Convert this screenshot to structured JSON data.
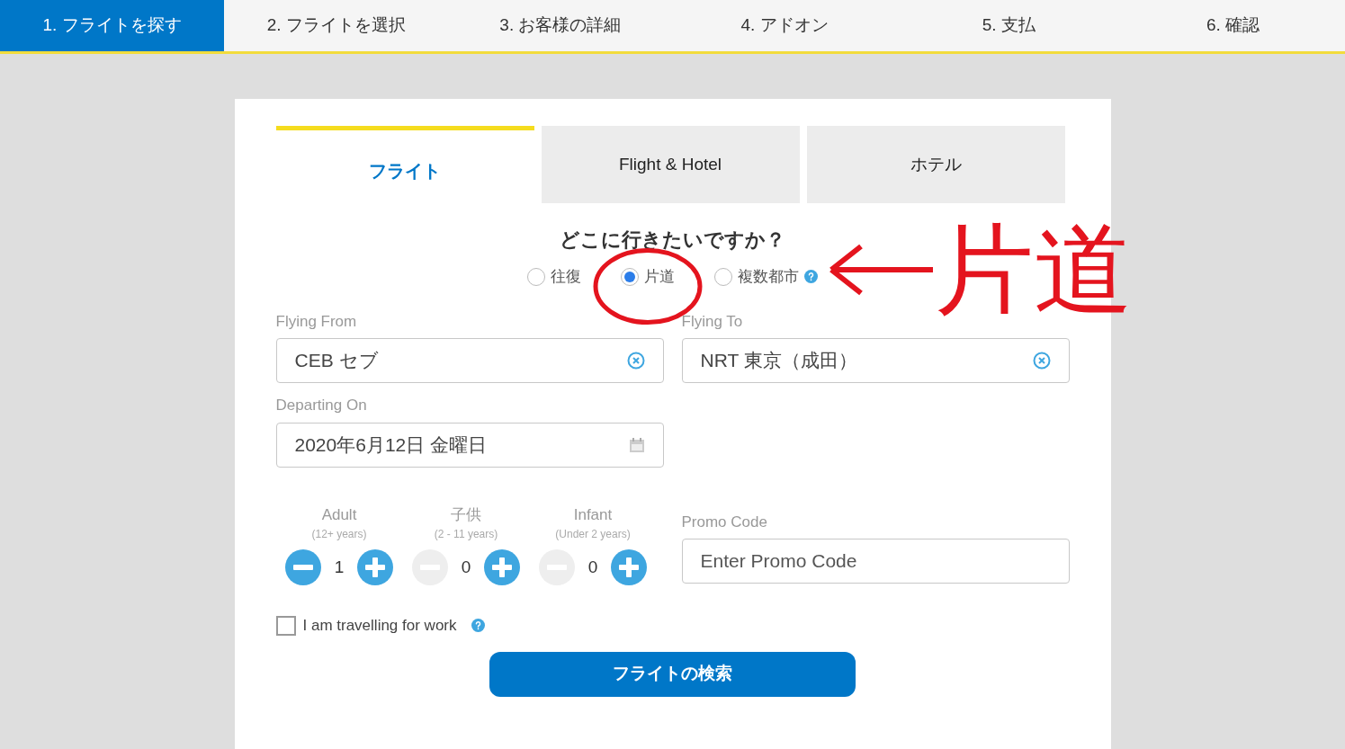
{
  "steps": [
    {
      "label": "1. フライトを探す",
      "selected": true
    },
    {
      "label": "2. フライトを選択",
      "selected": false
    },
    {
      "label": "3. お客様の詳細",
      "selected": false
    },
    {
      "label": "4. アドオン",
      "selected": false
    },
    {
      "label": "5. 支払",
      "selected": false
    },
    {
      "label": "6. 確認",
      "selected": false
    }
  ],
  "tabs": [
    {
      "label": "フライト",
      "selected": true
    },
    {
      "label": "Flight & Hotel",
      "selected": false
    },
    {
      "label": "ホテル",
      "selected": false
    }
  ],
  "question": "どこに行きたいですか？",
  "trip_types": [
    {
      "label": "往復",
      "selected": false,
      "help": false
    },
    {
      "label": "片道",
      "selected": true,
      "help": false
    },
    {
      "label": "複数都市",
      "selected": false,
      "help": true
    }
  ],
  "annotation": {
    "text": "片道"
  },
  "from": {
    "label": "Flying From",
    "value": "CEB セブ"
  },
  "to": {
    "label": "Flying To",
    "value": "NRT 東京（成田）"
  },
  "departing": {
    "label": "Departing On",
    "value": "2020年6月12日 金曜日"
  },
  "passengers": [
    {
      "label": "Adult",
      "sub": "(12+ years)",
      "count": "1",
      "minus_disabled": false
    },
    {
      "label": "子供",
      "sub": "(2 - 11 years)",
      "count": "0",
      "minus_disabled": true
    },
    {
      "label": "Infant",
      "sub": "(Under 2 years)",
      "count": "0",
      "minus_disabled": true
    }
  ],
  "promo": {
    "label": "Promo Code",
    "placeholder": "Enter Promo Code"
  },
  "work": {
    "label": "I am travelling for work",
    "checked": false
  },
  "search_button": "フライトの検索"
}
